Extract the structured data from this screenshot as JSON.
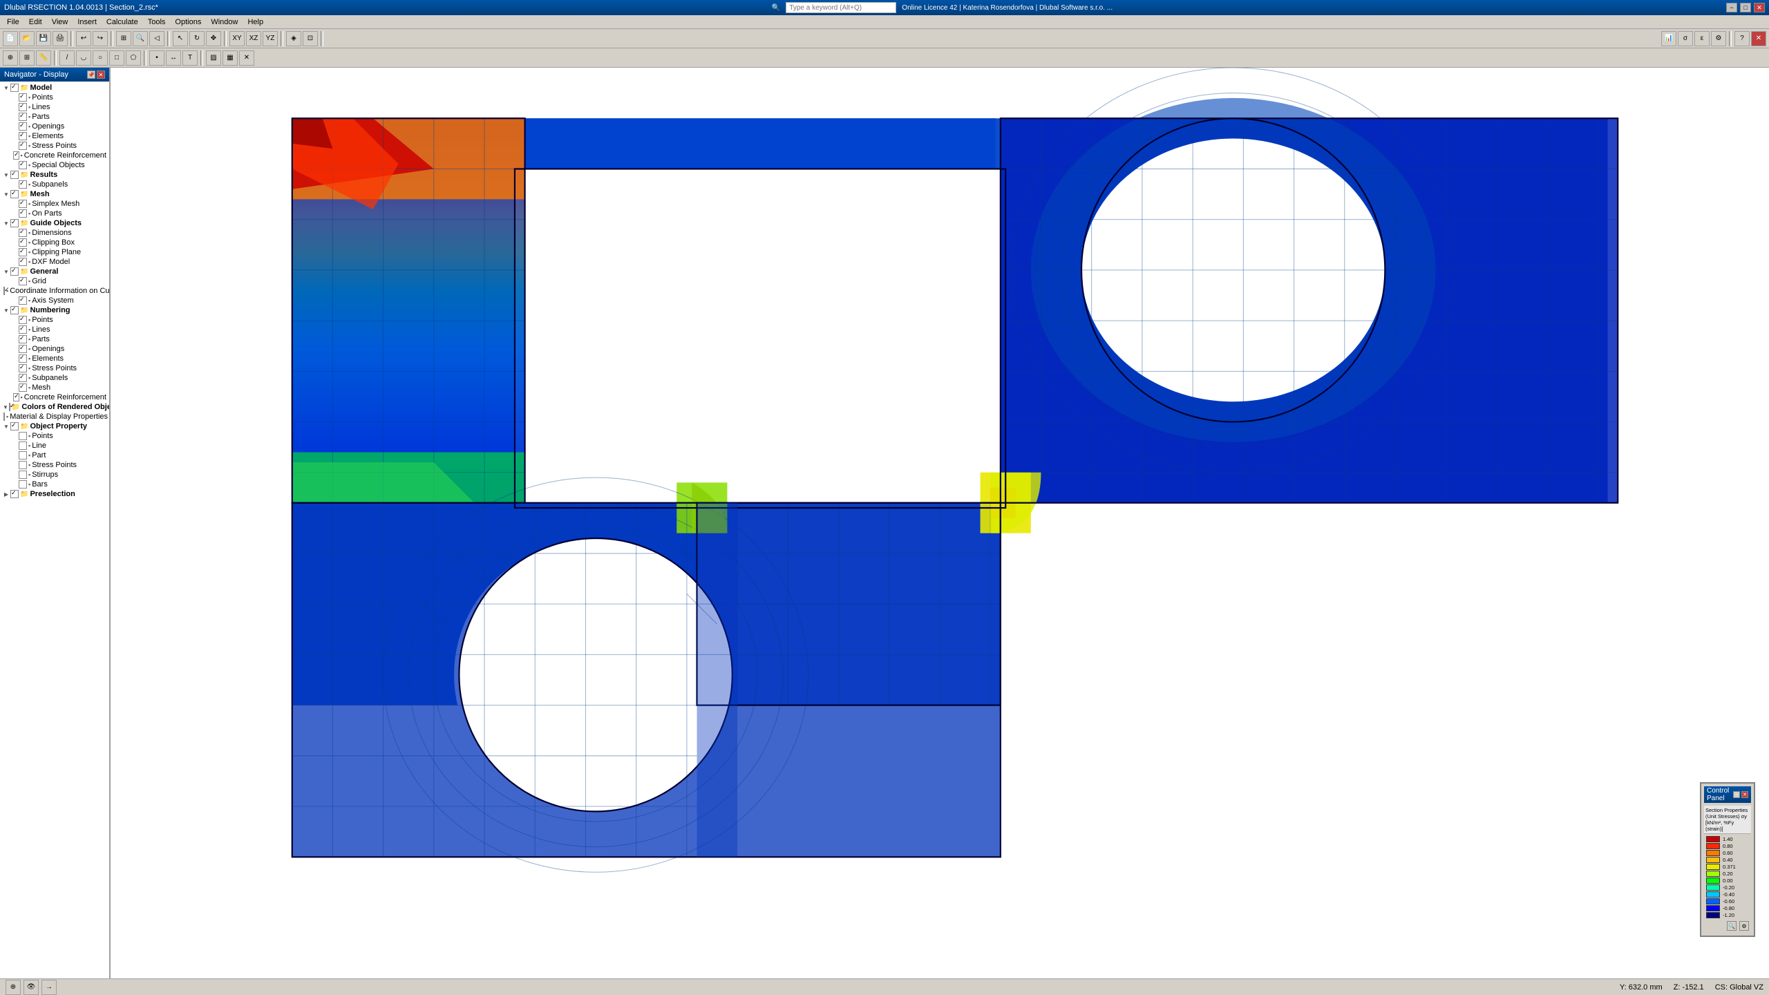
{
  "titlebar": {
    "title": "Dlubal RSECTION 1.04.0013 | Section_2.rsc*",
    "min": "−",
    "max": "□",
    "close": "✕"
  },
  "menu": {
    "items": [
      "File",
      "Edit",
      "View",
      "Insert",
      "Calculate",
      "Tools",
      "Options",
      "Window",
      "Help"
    ]
  },
  "search": {
    "placeholder": "Type a keyword (Alt+Q)"
  },
  "license": {
    "text": "Online Licence 42 | Katerina Rosendorfova | Dlubal Software s.r.o. ..."
  },
  "navigator": {
    "title": "Navigator - Display",
    "tree": [
      {
        "level": 0,
        "label": "Model",
        "type": "group",
        "checked": true,
        "expanded": true
      },
      {
        "level": 1,
        "label": "Points",
        "type": "item",
        "checked": true
      },
      {
        "level": 1,
        "label": "Lines",
        "type": "item",
        "checked": true
      },
      {
        "level": 1,
        "label": "Parts",
        "type": "item",
        "checked": true
      },
      {
        "level": 1,
        "label": "Openings",
        "type": "item",
        "checked": true
      },
      {
        "level": 1,
        "label": "Elements",
        "type": "item",
        "checked": true
      },
      {
        "level": 1,
        "label": "Stress Points",
        "type": "item",
        "checked": true
      },
      {
        "level": 1,
        "label": "Concrete Reinforcement",
        "type": "item",
        "checked": true
      },
      {
        "level": 1,
        "label": "Special Objects",
        "type": "item",
        "checked": true
      },
      {
        "level": 0,
        "label": "Results",
        "type": "group",
        "checked": true,
        "expanded": true
      },
      {
        "level": 1,
        "label": "Subpanels",
        "type": "item",
        "checked": true
      },
      {
        "level": 0,
        "label": "Mesh",
        "type": "group",
        "checked": true,
        "expanded": true
      },
      {
        "level": 1,
        "label": "Simplex Mesh",
        "type": "item",
        "checked": true
      },
      {
        "level": 1,
        "label": "On Parts",
        "type": "item",
        "checked": true
      },
      {
        "level": 0,
        "label": "Guide Objects",
        "type": "group",
        "checked": true,
        "expanded": true
      },
      {
        "level": 1,
        "label": "Dimensions",
        "type": "item",
        "checked": true
      },
      {
        "level": 1,
        "label": "Clipping Box",
        "type": "item",
        "checked": true
      },
      {
        "level": 1,
        "label": "Clipping Plane",
        "type": "item",
        "checked": true
      },
      {
        "level": 1,
        "label": "DXF Model",
        "type": "item",
        "checked": true
      },
      {
        "level": 0,
        "label": "General",
        "type": "group",
        "checked": true,
        "expanded": true
      },
      {
        "level": 1,
        "label": "Grid",
        "type": "item",
        "checked": true
      },
      {
        "level": 1,
        "label": "Coordinate Information on Cursor",
        "type": "item",
        "checked": true
      },
      {
        "level": 1,
        "label": "Axis System",
        "type": "item",
        "checked": true
      },
      {
        "level": 0,
        "label": "Numbering",
        "type": "group",
        "checked": true,
        "expanded": true
      },
      {
        "level": 1,
        "label": "Points",
        "type": "item",
        "checked": true
      },
      {
        "level": 1,
        "label": "Lines",
        "type": "item",
        "checked": true
      },
      {
        "level": 1,
        "label": "Parts",
        "type": "item",
        "checked": true
      },
      {
        "level": 1,
        "label": "Openings",
        "type": "item",
        "checked": true
      },
      {
        "level": 1,
        "label": "Elements",
        "type": "item",
        "checked": true
      },
      {
        "level": 1,
        "label": "Stress Points",
        "type": "item",
        "checked": true
      },
      {
        "level": 1,
        "label": "Subpanels",
        "type": "item",
        "checked": true
      },
      {
        "level": 1,
        "label": "Mesh",
        "type": "item",
        "checked": true
      },
      {
        "level": 1,
        "label": "Concrete Reinforcement",
        "type": "item",
        "checked": true
      },
      {
        "level": 0,
        "label": "Colors of Rendered Objects by",
        "type": "group",
        "checked": true,
        "expanded": true
      },
      {
        "level": 1,
        "label": "Material & Display Properties",
        "type": "item",
        "checked": false
      },
      {
        "level": 0,
        "label": "Object Property",
        "type": "group",
        "checked": true,
        "expanded": true
      },
      {
        "level": 1,
        "label": "Points",
        "type": "item",
        "checked": false
      },
      {
        "level": 1,
        "label": "Line",
        "type": "item",
        "checked": false
      },
      {
        "level": 1,
        "label": "Part",
        "type": "item",
        "checked": false
      },
      {
        "level": 1,
        "label": "Stress Points",
        "type": "item",
        "checked": false
      },
      {
        "level": 1,
        "label": "Stirrups",
        "type": "item",
        "checked": false
      },
      {
        "level": 1,
        "label": "Bars",
        "type": "item",
        "checked": false
      },
      {
        "level": 0,
        "label": "Preselection",
        "type": "group",
        "checked": true,
        "expanded": false
      }
    ]
  },
  "control_panel": {
    "title": "Control Panel",
    "subtitle": "Section Properties (Unit Stresses) σy [kN/m², %Fy (strain)]",
    "legend": [
      {
        "value": "1.40",
        "color": "#c80000"
      },
      {
        "value": "0.80",
        "color": "#ff2800"
      },
      {
        "value": "0.60",
        "color": "#ff7800"
      },
      {
        "value": "0.40",
        "color": "#ffbe00"
      },
      {
        "value": "0.371",
        "color": "#e8e800"
      },
      {
        "value": "0.20",
        "color": "#a0ff00"
      },
      {
        "value": "0.00",
        "color": "#00ff00"
      },
      {
        "value": "-0.20",
        "color": "#00ffb0"
      },
      {
        "value": "-0.40",
        "color": "#00c8ff"
      },
      {
        "value": "-0.60",
        "color": "#0064ff"
      },
      {
        "value": "-0.80",
        "color": "#0000ff"
      },
      {
        "value": "-1.20",
        "color": "#000080"
      }
    ]
  },
  "status_bar": {
    "left": "",
    "coords": "Y: 632.0 mm",
    "z_coord": "Z: -152.1",
    "cs": "CS: Global VZ"
  },
  "toolbar": {
    "buttons": [
      "New",
      "Open",
      "Save",
      "Print",
      "Undo",
      "Redo",
      "Select",
      "Move",
      "Zoom",
      "ZoomAll",
      "ZoomWindow",
      "ZoomPrev"
    ]
  }
}
